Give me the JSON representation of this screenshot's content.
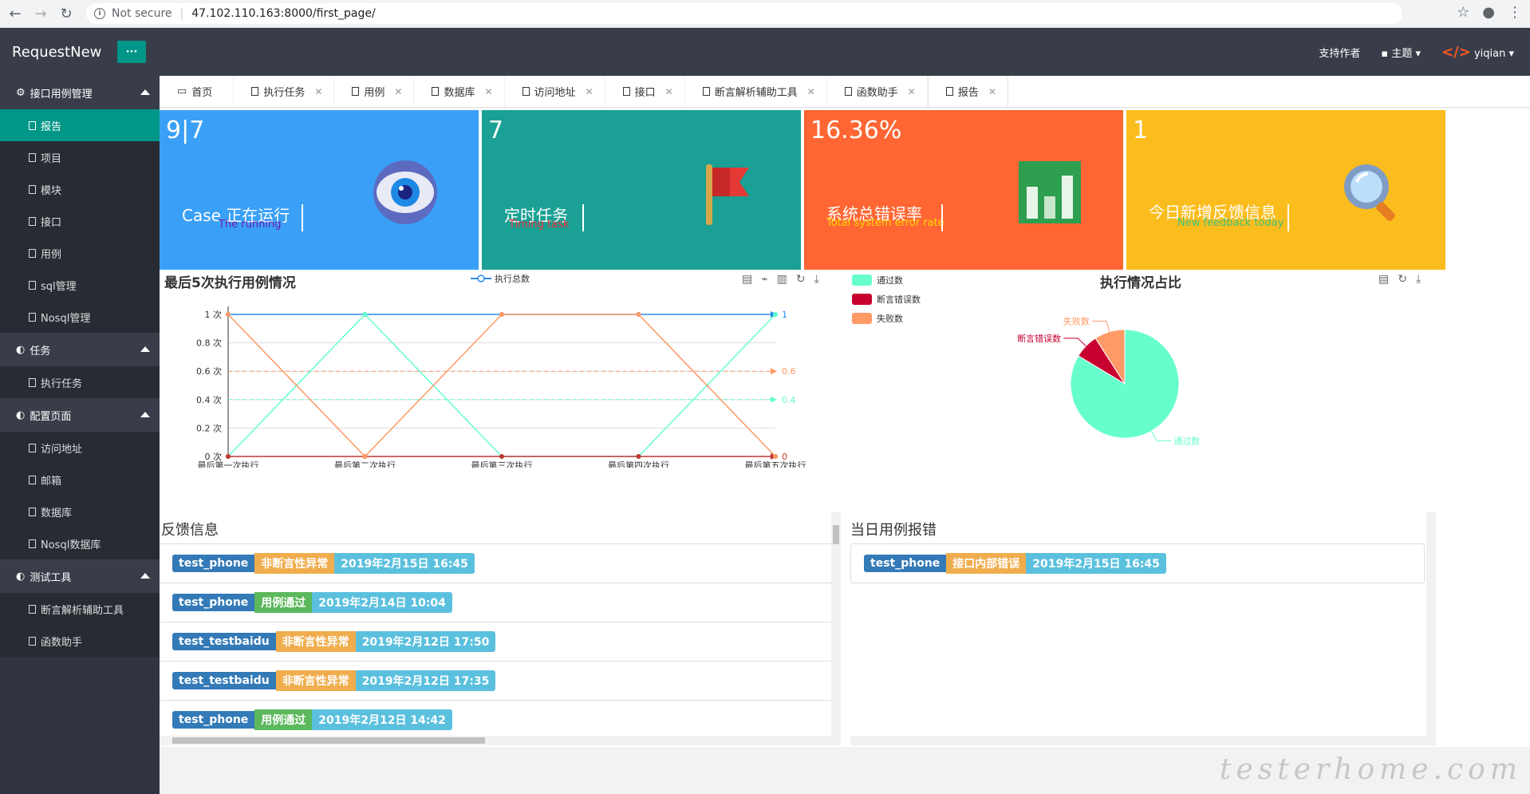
{
  "browser": {
    "security": "Not secure",
    "url": "47.102.110.163:8000/first_page/"
  },
  "header": {
    "title": "RequestNew",
    "menu_label": "···",
    "support": "支持作者",
    "theme": "主题",
    "user": "yiqian"
  },
  "sidebar": {
    "groups": [
      {
        "label": "接口用例管理",
        "items": [
          "报告",
          "项目",
          "模块",
          "接口",
          "用例",
          "sql管理",
          "Nosql管理"
        ]
      },
      {
        "label": "任务",
        "items": [
          "执行任务"
        ]
      },
      {
        "label": "配置页面",
        "items": [
          "访问地址",
          "邮箱",
          "数据库",
          "Nosql数据库"
        ]
      },
      {
        "label": "测试工具",
        "items": [
          "断言解析辅助工具",
          "函数助手"
        ]
      }
    ]
  },
  "tabs": [
    "首页",
    "执行任务",
    "用例",
    "数据库",
    "访问地址",
    "接口",
    "断言解析辅助工具",
    "函数助手",
    "报告"
  ],
  "cards": [
    {
      "num": "9|7",
      "title": "Case 正在运行",
      "sub": "The running",
      "color": "#3aa0f7",
      "sub_color": "#6a1fb5"
    },
    {
      "num": "7",
      "title": "定时任务",
      "sub": "Timing task",
      "color": "#1aa094",
      "sub_color": "#e7313a"
    },
    {
      "num": "16.36%",
      "title": "系统总错误率",
      "sub": "Total system error rate",
      "color": "#ff6633",
      "sub_color": "#ffd700"
    },
    {
      "num": "1",
      "title": "今日新增反馈信息",
      "sub": "New feedback today",
      "color": "#fbbd1e",
      "sub_color": "#3ec27a"
    }
  ],
  "line_panel": {
    "title": "最后5次执行用例情况",
    "legend": "执行总数"
  },
  "pie_panel": {
    "title": "执行情况占比"
  },
  "feedback": {
    "title": "反馈信息",
    "rows": [
      {
        "name": "test_phone",
        "status": "非断言性异常",
        "kind": "warning",
        "time": "2019年2月15日 16:45"
      },
      {
        "name": "test_phone",
        "status": "用例通过",
        "kind": "success",
        "time": "2019年2月14日 10:04"
      },
      {
        "name": "test_testbaidu",
        "status": "非断言性异常",
        "kind": "warning",
        "time": "2019年2月12日 17:50"
      },
      {
        "name": "test_testbaidu",
        "status": "非断言性异常",
        "kind": "warning",
        "time": "2019年2月12日 17:35"
      },
      {
        "name": "test_phone",
        "status": "用例通过",
        "kind": "success",
        "time": "2019年2月12日 14:42"
      }
    ]
  },
  "errors": {
    "title": "当日用例报错",
    "rows": [
      {
        "name": "test_phone",
        "status": "接口内部错误",
        "kind": "warning",
        "time": "2019年2月15日 16:45"
      }
    ]
  },
  "watermark": "testerhome.com",
  "chart_data": [
    {
      "type": "line",
      "title": "最后5次执行用例情况",
      "categories": [
        "最后第一次执行",
        "最后第二次执行",
        "最后第三次执行",
        "最后第四次执行",
        "最后第五次执行"
      ],
      "yticks": [
        "0 次",
        "0.2 次",
        "0.4 次",
        "0.6 次",
        "0.8 次",
        "1 次"
      ],
      "ylim": [
        0,
        1
      ],
      "series": [
        {
          "name": "执行总数",
          "values": [
            1,
            1,
            1,
            1,
            1
          ],
          "color": "#2a8cf0",
          "end_label": "1"
        },
        {
          "values": [
            0,
            1,
            0,
            0,
            1
          ],
          "color": "#66ffcc",
          "end_label": "0.4",
          "avg": 0.4
        },
        {
          "values": [
            0,
            0,
            0,
            0,
            0
          ],
          "color": "#c23531",
          "end_label": "0"
        },
        {
          "values": [
            1,
            0,
            1,
            1,
            0
          ],
          "color": "#ff9966",
          "end_label": "0.6",
          "avg": 0.6
        }
      ]
    },
    {
      "type": "pie",
      "title": "执行情况占比",
      "slices": [
        {
          "name": "通过数",
          "value": 46,
          "color": "#66ffcc"
        },
        {
          "name": "断言错误数",
          "value": 4,
          "color": "#c7002f"
        },
        {
          "name": "失败数",
          "value": 5,
          "color": "#ff9966"
        }
      ]
    }
  ]
}
